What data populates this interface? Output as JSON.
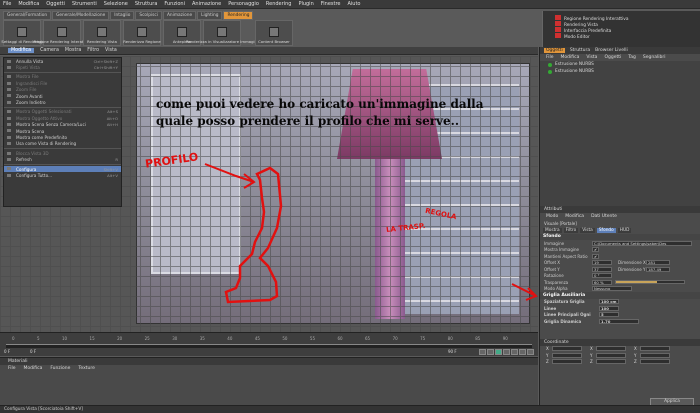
{
  "menubar": [
    "File",
    "Modifica",
    "Oggetti",
    "Strumenti",
    "Selezione",
    "Struttura",
    "Funzioni",
    "Animazione",
    "Personaggio",
    "Rendering",
    "Plugin",
    "Finestre",
    "Aiuto"
  ],
  "layout_tabs": [
    {
      "label": "General/Formation",
      "active": false
    },
    {
      "label": "Generale/Modellazione",
      "active": false
    },
    {
      "label": "Intaglio",
      "active": false
    },
    {
      "label": "Scolpisci",
      "active": false
    },
    {
      "label": "Animazione",
      "active": false
    },
    {
      "label": "Lighting",
      "active": false
    },
    {
      "label": "Rendering",
      "active": true
    }
  ],
  "toolbar": [
    {
      "label": "Settaggi di Rendering",
      "icon": "render-settings-icon"
    },
    {
      "label": "Regione Rendering Interattiva",
      "icon": "interactive-render-icon"
    },
    {
      "label": "Rendering Vista",
      "icon": "render-view-icon"
    },
    {
      "label": "Renderizza Regione",
      "icon": "render-region-icon"
    },
    {
      "label": "Antepima",
      "icon": "preview-icon"
    },
    {
      "label": "Renderizza in Visualizzatore Immagini",
      "icon": "picture-viewer-icon"
    },
    {
      "label": "Content Browser",
      "icon": "content-browser-icon"
    }
  ],
  "right_header": [
    "Regione Rendering Interattiva",
    "Rendering Vista",
    "Interfaccia Predefinita",
    "Modo Editor"
  ],
  "viewport_menu": [
    {
      "label": "Modifica",
      "active": true
    },
    {
      "label": "Camera",
      "active": false
    },
    {
      "label": "Mostra",
      "active": false
    },
    {
      "label": "Filtro",
      "active": false
    },
    {
      "label": "Vista",
      "active": false
    }
  ],
  "dropdown": [
    {
      "label": "Annulla Vista",
      "sc": "Ctrl+Shift+Z",
      "state": "normal"
    },
    {
      "label": "Ripeti Vista",
      "sc": "Ctrl+Shift+Y",
      "state": "dis"
    },
    {
      "label": "",
      "sep": true
    },
    {
      "label": "Mostra File",
      "sc": "",
      "state": "dis"
    },
    {
      "label": "Ingrandisci File",
      "sc": "",
      "state": "dis"
    },
    {
      "label": "Zoom File",
      "sc": "",
      "state": "dis"
    },
    {
      "label": "Zoom Avanti",
      "sc": "",
      "state": "normal"
    },
    {
      "label": "Zoom Indietro",
      "sc": "",
      "state": "normal"
    },
    {
      "label": "",
      "sep": true
    },
    {
      "label": "Mostra Oggetti Selezionati",
      "sc": "Alt+S",
      "state": "dis"
    },
    {
      "label": "Mostra Oggetto Attivo",
      "sc": "Alt+O",
      "state": "dis"
    },
    {
      "label": "Mostra Scena Senza Camera/Luci",
      "sc": "Alt+H",
      "state": "normal"
    },
    {
      "label": "Mostra Scena",
      "sc": "",
      "state": "normal"
    },
    {
      "label": "Mostra come Predefinito",
      "sc": "",
      "state": "normal"
    },
    {
      "label": "Usa come Vista di Rendering",
      "sc": "",
      "state": "normal"
    },
    {
      "label": "",
      "sep": true
    },
    {
      "label": "Blocca Vista 3D",
      "sc": "",
      "state": "dis"
    },
    {
      "label": "Refresh",
      "sc": "R",
      "state": "normal"
    },
    {
      "label": "",
      "sep": true
    },
    {
      "label": "Configura",
      "sc": "Shift+V",
      "state": "sel"
    },
    {
      "label": "Configura Tutto...",
      "sc": "Alt+V",
      "state": "normal"
    }
  ],
  "caption": "come puoi vedere ho caricato un'immagine dalla quale posso prendere il profilo che mi serve..",
  "annotations": {
    "profilo": "PROFILO",
    "regola1": "REGOLA",
    "regola2": "LA TRASP."
  },
  "timeline_ticks": [
    "0",
    "5",
    "10",
    "15",
    "20",
    "25",
    "30",
    "35",
    "40",
    "45",
    "50",
    "55",
    "60",
    "65",
    "70",
    "75",
    "80",
    "85",
    "90"
  ],
  "timeline": {
    "start": "0 F",
    "end": "90 F",
    "current": "0 F"
  },
  "materials": {
    "title": "Materiali",
    "menu": [
      "File",
      "Modifica",
      "Funzione",
      "Texture"
    ]
  },
  "obj_manager": {
    "tabs": [
      {
        "label": "Oggetti",
        "active": true
      },
      {
        "label": "Struttura",
        "active": false
      },
      {
        "label": "Browser Livelli",
        "active": false
      }
    ],
    "menu": [
      "File",
      "Modifica",
      "Vista",
      "Oggetti",
      "Tag",
      "Segnalibri"
    ],
    "items": [
      "Estrusione NURBS",
      "Estrusione NURBS"
    ]
  },
  "attributes": {
    "title": "Attributi",
    "menu": [
      "Modo",
      "Modifica",
      "Dati Utente"
    ],
    "subtitle": "Visuale [Portale]",
    "tabs": [
      {
        "label": "Mostra",
        "active": false
      },
      {
        "label": "Filtro",
        "active": false
      },
      {
        "label": "Vista",
        "active": false
      },
      {
        "label": "Sfondo",
        "active": true
      },
      {
        "label": "HUD",
        "active": false
      }
    ],
    "section": "Sfondo",
    "image_path": "C:\\Documents and Settings\\saber\\Des",
    "fields": [
      {
        "label": "Immagine",
        "value": "C:\\Documents and Settings\\saber\\Des"
      },
      {
        "label": "Mostra Immagine",
        "value": "✔"
      },
      {
        "label": "Mantieni Aspect Ratio",
        "value": "✔"
      }
    ],
    "pairs": [
      {
        "l1": "Offset X",
        "v1": "19",
        "l2": "Dimensione X",
        "v2": "281"
      },
      {
        "l1": "Offset Y",
        "v1": "37",
        "l2": "Dimensione Y",
        "v2": "187.49"
      },
      {
        "l1": "Rotazione",
        "v1": "0 °",
        "l2": "",
        "v2": ""
      }
    ],
    "transparency": {
      "label": "Trasparenza",
      "value": "60 %",
      "level": 0.6
    },
    "alpha": {
      "label": "Modo Alpha",
      "value": "Nessuno"
    },
    "grid_section": "Griglia Ausiliaria",
    "grid_fields": [
      {
        "label": "Spaziatura Griglia",
        "value": "100 cm"
      },
      {
        "label": "Linee",
        "value": "100"
      },
      {
        "label": "Linee Principali Ogni",
        "value": "5"
      },
      {
        "label": "Griglia Dinamica",
        "value": "1.70"
      }
    ]
  },
  "coordinates": {
    "title": "Coordinate",
    "labels": [
      "X",
      "Y",
      "Z"
    ],
    "apply": "Applica"
  },
  "status": "Configura Vista [Scorciatoia Shift+V]"
}
